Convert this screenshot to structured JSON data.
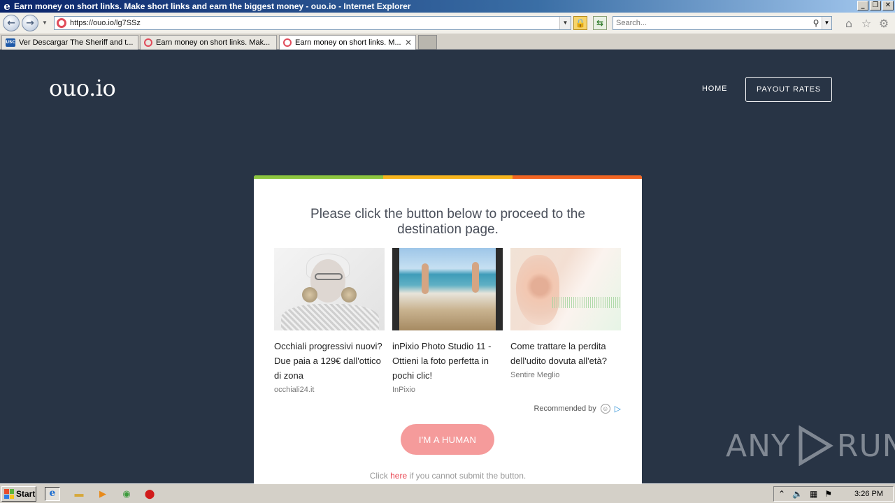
{
  "browser": {
    "title": "Earn money on short links. Make short links and earn the biggest money - ouo.io - Internet Explorer",
    "address": "https://ouo.io/lg7SSz",
    "search_placeholder": "Search...",
    "tabs": [
      {
        "label": "Ver Descargar The Sheriff and t..."
      },
      {
        "label": "Earn money on short links. Mak..."
      },
      {
        "label": "Earn money on short links. M..."
      }
    ]
  },
  "site": {
    "brand": "ouo.io",
    "nav": {
      "home": "HOME",
      "payout": "PAYOUT RATES"
    }
  },
  "card": {
    "heading": "Please click the button below to proceed to the destination page.",
    "accent_colors": [
      "#8dc63f",
      "#f7b51d",
      "#f26522"
    ],
    "ads": [
      {
        "headline": "Occhiali progressivi nuovi? Due paia a 129€ dall'ottico di zona",
        "source": "occhiali24.it"
      },
      {
        "headline": "inPixio Photo Studio 11 - Ottieni la foto perfetta in pochi clic!",
        "source": "InPixio"
      },
      {
        "headline": "Come trattare la perdita dell'udito dovuta all'età?",
        "source": "Sentire Meglio"
      }
    ],
    "recommended_by": "Recommended by",
    "button_label": "I'M A HUMAN",
    "fallback": {
      "before": "Click ",
      "link": "here",
      "after": " if you cannot submit the button."
    }
  },
  "watermark": {
    "left": "ANY",
    "right": "RUN"
  },
  "taskbar": {
    "start": "Start",
    "clock": "3:26 PM"
  }
}
